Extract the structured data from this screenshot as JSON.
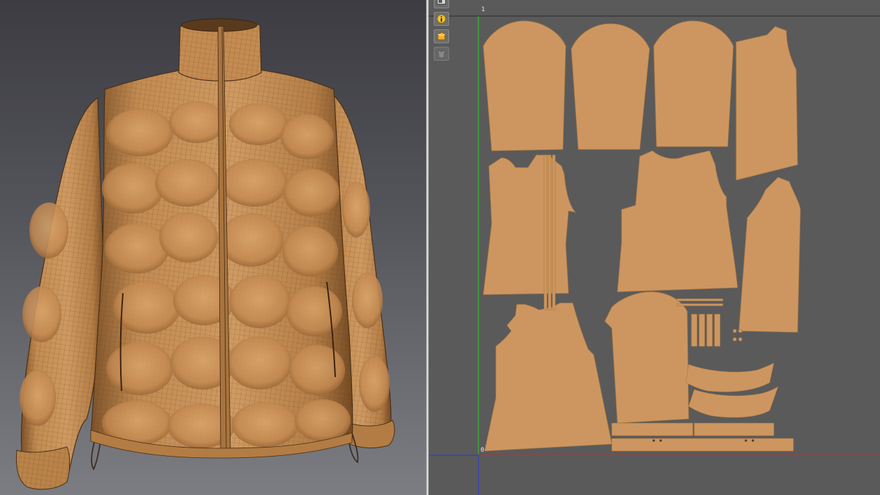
{
  "uv_editor": {
    "axis_labels": {
      "v_one": "1",
      "origin": "0"
    },
    "tools": [
      {
        "name": "display-mode-icon"
      },
      {
        "name": "info-icon"
      },
      {
        "name": "material-icon"
      },
      {
        "name": "pattern-icon"
      }
    ]
  },
  "colors": {
    "fabric": "#cd9660",
    "fabric_outline": "#a87842",
    "uv_background": "#5a5a5a",
    "grid_line_top": "#3a3a3a",
    "axis_v": "#33cc33",
    "axis_u": "#d02a2a",
    "axis_origin_v": "#2b3bd6"
  }
}
